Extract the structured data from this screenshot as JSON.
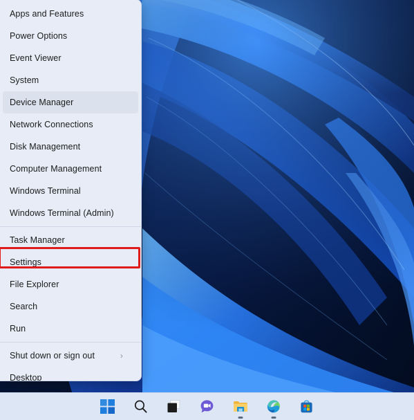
{
  "desktop": {
    "wallpaper_name": "windows-11-bloom-wallpaper",
    "colors": {
      "deep_navy": "#061638",
      "mid_blue": "#0e3ba5",
      "bright_blue": "#2f86f5",
      "highlight_blue": "#5aa9ff"
    }
  },
  "winx_menu": {
    "name": "win-x-power-user-menu",
    "background_color": "#e7ecf7",
    "groups": [
      {
        "items": [
          {
            "label": "Apps and Features",
            "state": "normal",
            "submenu": false
          },
          {
            "label": "Power Options",
            "state": "normal",
            "submenu": false
          },
          {
            "label": "Event Viewer",
            "state": "normal",
            "submenu": false
          },
          {
            "label": "System",
            "state": "normal",
            "submenu": false
          },
          {
            "label": "Device Manager",
            "state": "hover",
            "submenu": false
          },
          {
            "label": "Network Connections",
            "state": "normal",
            "submenu": false
          },
          {
            "label": "Disk Management",
            "state": "normal",
            "submenu": false
          },
          {
            "label": "Computer Management",
            "state": "normal",
            "submenu": false
          },
          {
            "label": "Windows Terminal",
            "state": "normal",
            "submenu": false
          },
          {
            "label": "Windows Terminal (Admin)",
            "state": "normal",
            "submenu": false
          }
        ]
      },
      {
        "items": [
          {
            "label": "Task Manager",
            "state": "normal",
            "submenu": false
          },
          {
            "label": "Settings",
            "state": "highlighted",
            "submenu": false
          },
          {
            "label": "File Explorer",
            "state": "normal",
            "submenu": false
          },
          {
            "label": "Search",
            "state": "normal",
            "submenu": false
          },
          {
            "label": "Run",
            "state": "normal",
            "submenu": false
          }
        ]
      },
      {
        "items": [
          {
            "label": "Shut down or sign out",
            "state": "normal",
            "submenu": true,
            "submenu_glyph": "›"
          },
          {
            "label": "Desktop",
            "state": "normal",
            "submenu": false
          }
        ]
      }
    ],
    "annotation": {
      "type": "red-rectangle-highlight",
      "target_label": "Settings",
      "color": "#e01b1b"
    }
  },
  "taskbar": {
    "background_color": "#dde6f5",
    "buttons": [
      {
        "name": "start-button",
        "label": "Start",
        "running": false
      },
      {
        "name": "search-button",
        "label": "Search",
        "running": false
      },
      {
        "name": "task-view-button",
        "label": "Task View",
        "running": false
      },
      {
        "name": "chat-button",
        "label": "Chat",
        "running": false
      },
      {
        "name": "file-explorer-button",
        "label": "File Explorer",
        "running": true
      },
      {
        "name": "edge-button",
        "label": "Microsoft Edge",
        "running": true
      },
      {
        "name": "microsoft-store-button",
        "label": "Microsoft Store",
        "running": false
      }
    ]
  }
}
